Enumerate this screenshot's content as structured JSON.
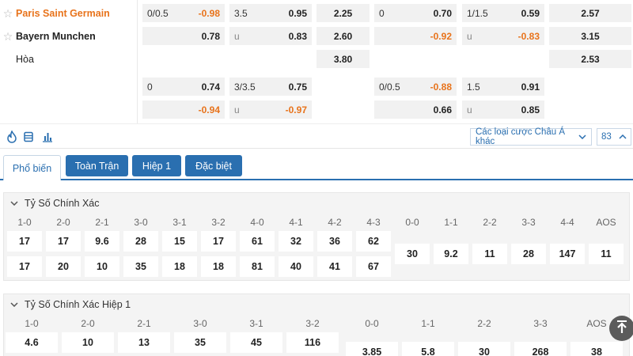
{
  "teams": {
    "home": "Paris Saint Germain",
    "away": "Bayern Munchen",
    "draw": "Hòa"
  },
  "odds_rows": [
    [
      {
        "k": "0/0.5",
        "v": "-0.98",
        "neg": true
      },
      {
        "k": "3.5",
        "v": "0.95",
        "neg": false
      },
      {
        "k": "",
        "v": "2.25",
        "center": true
      },
      {
        "k": "0",
        "v": "0.70",
        "neg": false
      },
      {
        "k": "1/1.5",
        "v": "0.59",
        "neg": false
      },
      {
        "k": "",
        "v": "2.57",
        "center": true
      }
    ],
    [
      {
        "k": "",
        "v": "0.78",
        "neg": false
      },
      {
        "k": "u",
        "v": "0.83",
        "neg": false
      },
      {
        "k": "",
        "v": "2.60",
        "center": true
      },
      {
        "k": "",
        "v": "-0.92",
        "neg": true
      },
      {
        "k": "u",
        "v": "-0.83",
        "neg": true
      },
      {
        "k": "",
        "v": "3.15",
        "center": true
      }
    ],
    [
      null,
      null,
      {
        "k": "",
        "v": "3.80",
        "center": true
      },
      null,
      null,
      {
        "k": "",
        "v": "2.53",
        "center": true
      }
    ],
    [
      {
        "k": "0",
        "v": "0.74",
        "neg": false
      },
      {
        "k": "3/3.5",
        "v": "0.75",
        "neg": false
      },
      null,
      {
        "k": "0/0.5",
        "v": "-0.88",
        "neg": true
      },
      {
        "k": "1.5",
        "v": "0.91",
        "neg": false
      },
      null
    ],
    [
      {
        "k": "",
        "v": "-0.94",
        "neg": true
      },
      {
        "k": "u",
        "v": "-0.97",
        "neg": true
      },
      null,
      {
        "k": "",
        "v": "0.66",
        "neg": false
      },
      {
        "k": "u",
        "v": "0.85",
        "neg": false
      },
      null
    ]
  ],
  "toolbar": {
    "bet_type_select": "Các loại cược Châu Á khác",
    "count_select": "83"
  },
  "tabs": [
    "Phổ biến",
    "Toàn Trận",
    "Hiệp 1",
    "Đặc biệt"
  ],
  "correct_score": {
    "title": "Tỷ Số Chính Xác",
    "pair_labels": [
      "1-0",
      "2-0",
      "2-1",
      "3-0",
      "3-1",
      "3-2",
      "4-0",
      "4-1",
      "4-2",
      "4-3"
    ],
    "row1": [
      "17",
      "17",
      "9.6",
      "28",
      "15",
      "17",
      "61",
      "32",
      "36",
      "62"
    ],
    "row2": [
      "17",
      "20",
      "10",
      "35",
      "18",
      "18",
      "81",
      "40",
      "41",
      "67"
    ],
    "draw_labels": [
      "0-0",
      "1-1",
      "2-2",
      "3-3",
      "4-4",
      "AOS"
    ],
    "draw_values": [
      "30",
      "9.2",
      "11",
      "28",
      "147",
      "11"
    ]
  },
  "correct_score_h1": {
    "title": "Tỷ Số Chính Xác Hiệp 1",
    "pair_labels": [
      "1-0",
      "2-0",
      "2-1",
      "3-0",
      "3-1",
      "3-2"
    ],
    "row1": [
      "4.6",
      "10",
      "13",
      "35",
      "45",
      "116"
    ],
    "draw_labels": [
      "0-0",
      "1-1",
      "2-2",
      "3-3",
      "AOS"
    ],
    "draw_values": [
      "3.85",
      "5.8",
      "30",
      "268",
      "38"
    ]
  },
  "colors": {
    "accent": "#2a6fb0",
    "home_team": "#e8731b",
    "negative_odds": "#e8731b"
  }
}
